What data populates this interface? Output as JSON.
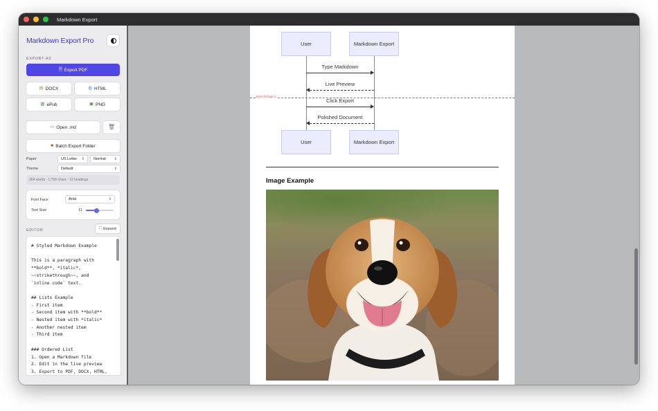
{
  "window": {
    "title": "Markdown Export"
  },
  "sidebar": {
    "brand": "Markdown Export Pro",
    "export_as_label": "EXPORT AS",
    "export_pdf": "Export PDF",
    "docx": "DOCX",
    "html": "HTML",
    "epub": "ePub",
    "png": "PNG",
    "open_md": "Open .md",
    "batch_export": "Batch Export Folder",
    "paper_label": "Paper",
    "paper_size": "US Letter",
    "paper_margin": "Normal",
    "theme_label": "Theme",
    "theme_value": "Default",
    "stats": "264 words · 1,766 chars · 12 headings",
    "font_face_label": "Font Face",
    "font_face_value": "Arial",
    "text_size_label": "Text Size",
    "text_size_value": "11",
    "text_size_fraction": 0.38,
    "editor_label": "EDITOR",
    "expand_label": "Expand"
  },
  "editor": {
    "lines": [
      "# Styled Markdown Example",
      "",
      "This is a paragraph with",
      "**bold**, *italic*,",
      "~~strikethrough~~, and",
      "`inline code` text.",
      "",
      "## Lists Example",
      "- First item",
      "- Second item with **bold**",
      "- Nested item with *italic*",
      "- Another nested item",
      "- Third item",
      "",
      "### Ordered List",
      "1. Open a Markdown file",
      "2. Edit in the live preview",
      "3. Export to PDF, DOCX, HTML,"
    ]
  },
  "preview": {
    "actors": {
      "left_top": "User",
      "right_top": "Markdown Export",
      "left_bottom": "User",
      "right_bottom": "Markdown Export"
    },
    "messages": [
      "Type Markdown",
      "Live Preview",
      "Click Export",
      "Polished Document"
    ],
    "page_break_label": "End of Page 2",
    "image_heading": "Image Example"
  },
  "colors": {
    "accent": "#4f46e5",
    "brand": "#4338ca",
    "page_break": "#e05252",
    "actor_fill": "#ececff"
  },
  "icons": {
    "theme": "half-circle-icon",
    "pdf": "document-icon",
    "docx": "doc-icon",
    "html": "globe-icon",
    "epub": "book-icon",
    "png": "image-icon",
    "open": "folder-icon",
    "trash": "trash-icon",
    "batch": "package-icon",
    "expand": "expand-icon"
  }
}
